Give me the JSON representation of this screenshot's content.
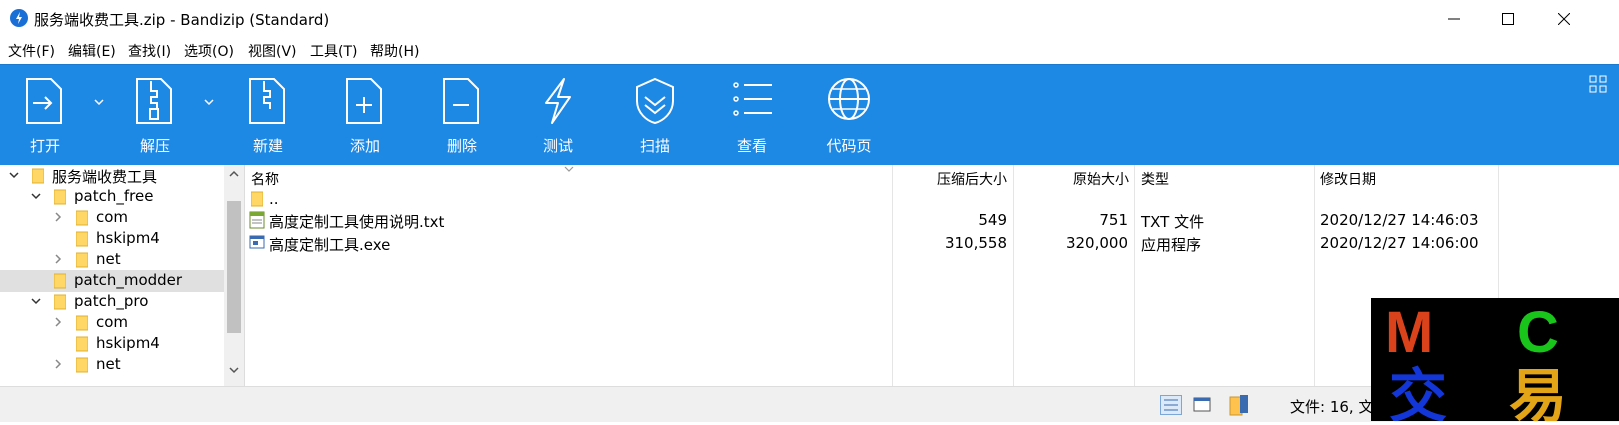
{
  "window": {
    "title": "服务端收费工具.zip - Bandizip (Standard)",
    "minimize_icon": "minimize-icon",
    "maximize_icon": "maximize-icon",
    "close_icon": "close-icon"
  },
  "menu": [
    "文件(F)",
    "编辑(E)",
    "查找(I)",
    "选项(O)",
    "视图(V)",
    "工具(T)",
    "帮助(H)"
  ],
  "toolbar": {
    "open": "打开",
    "extract": "解压",
    "new": "新建",
    "add": "添加",
    "delete": "删除",
    "test": "测试",
    "scan": "扫描",
    "view": "查看",
    "codepage": "代码页"
  },
  "tree": [
    {
      "label": "服务端收费工具",
      "level": 0,
      "expanded": true
    },
    {
      "label": "patch_free",
      "level": 1,
      "expanded": true
    },
    {
      "label": "com",
      "level": 2,
      "expanded": false
    },
    {
      "label": "hskipm4",
      "level": 2,
      "expanded": null
    },
    {
      "label": "net",
      "level": 2,
      "expanded": false
    },
    {
      "label": "patch_modder",
      "level": 1,
      "expanded": null,
      "selected": true
    },
    {
      "label": "patch_pro",
      "level": 1,
      "expanded": true
    },
    {
      "label": "com",
      "level": 2,
      "expanded": false
    },
    {
      "label": "hskipm4",
      "level": 2,
      "expanded": null
    },
    {
      "label": "net",
      "level": 2,
      "expanded": false
    }
  ],
  "columns": {
    "name": "名称",
    "compressed": "压缩后大小",
    "original": "原始大小",
    "type": "类型",
    "modified": "修改日期"
  },
  "files": [
    {
      "name": "..",
      "compressed": "",
      "original": "",
      "type": "",
      "modified": "",
      "icon": "folder-icon"
    },
    {
      "name": "高度定制工具使用说明.txt",
      "compressed": "549",
      "original": "751",
      "type": "TXT 文件",
      "modified": "2020/12/27 14:46:03",
      "icon": "text-file-icon"
    },
    {
      "name": "高度定制工具.exe",
      "compressed": "310,558",
      "original": "320,000",
      "type": "应用程序",
      "modified": "2020/12/27 14:06:00",
      "icon": "exe-file-icon"
    }
  ],
  "status": {
    "text": "文件: 16, 文"
  },
  "overlay_logo": {
    "letters": [
      "M",
      "C",
      "交",
      "易"
    ],
    "colors": [
      "#d9421a",
      "#19c51a",
      "#1336d9",
      "#e3a418"
    ]
  },
  "colors": {
    "toolbar_bg": "#1e88e5",
    "selection": "#e0e0e0"
  }
}
